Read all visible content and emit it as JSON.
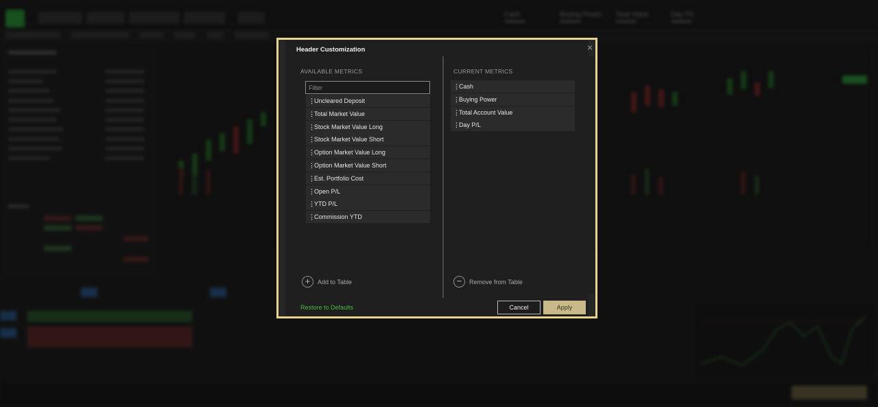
{
  "header": {
    "metrics": [
      {
        "label": "Cash",
        "value": "************"
      },
      {
        "label": "Buying Power",
        "value": "************"
      },
      {
        "label": "Total Value",
        "value": "************"
      },
      {
        "label": "Day P/L",
        "value": "************"
      }
    ]
  },
  "dialog": {
    "title": "Header Customization",
    "close_icon": "close-icon",
    "available": {
      "heading": "AVAILABLE METRICS",
      "filter_placeholder": "Filter",
      "items": [
        "Uncleared Deposit",
        "Total Market Value",
        "Stock Market Value Long",
        "Stock Market Value Short",
        "Option Market Value Long",
        "Option Market Value Short",
        "Est. Portfolio Cost",
        "Open P/L",
        "YTD P/L",
        "Commission YTD"
      ],
      "add_label": "Add to Table"
    },
    "current": {
      "heading": "CURRENT METRICS",
      "items": [
        "Cash",
        "Buying Power",
        "Total Account Value",
        "Day P/L"
      ],
      "remove_label": "Remove from Table"
    },
    "restore_label": "Restore to Defaults",
    "cancel_label": "Cancel",
    "apply_label": "Apply"
  },
  "colors": {
    "dialog_border": "#e8d48e",
    "apply_button": "#c9b98a",
    "restore_link": "#47b93f",
    "brand_green": "#2ecc40"
  }
}
